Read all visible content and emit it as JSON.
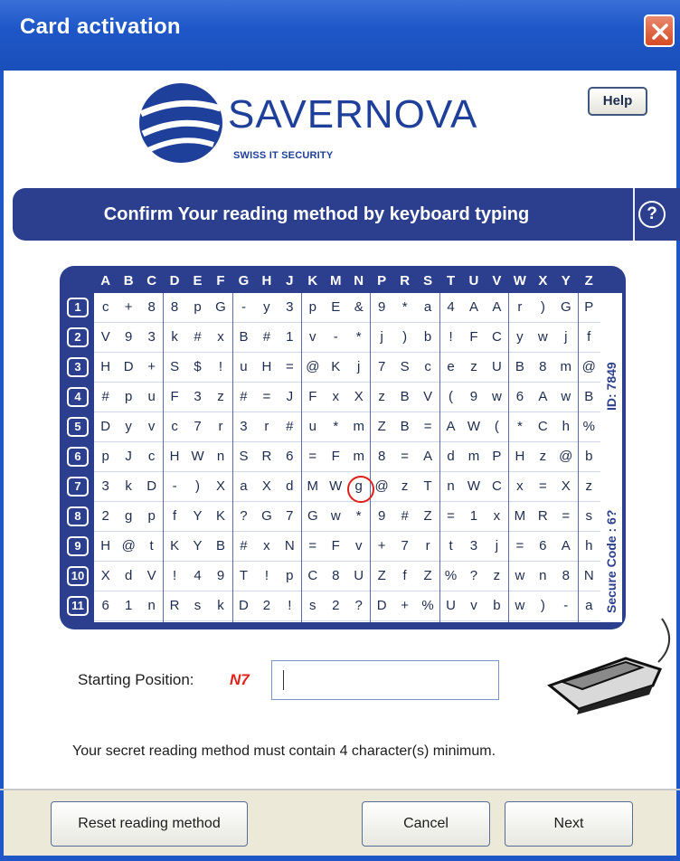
{
  "window": {
    "title": "Card activation"
  },
  "logo": {
    "name": "SAVERNOVA",
    "tagline": "SWISS IT SECURITY"
  },
  "help_label": "Help",
  "banner": {
    "text": "Confirm Your reading method by keyboard typing",
    "help_icon": "?"
  },
  "grid": {
    "columns": [
      "A",
      "B",
      "C",
      "D",
      "E",
      "F",
      "G",
      "H",
      "J",
      "K",
      "M",
      "N",
      "P",
      "R",
      "S",
      "T",
      "U",
      "V",
      "W",
      "X",
      "Y",
      "Z"
    ],
    "rows": [
      {
        "label": "1",
        "cells": [
          "c",
          "+",
          "8",
          "8",
          "p",
          "G",
          "-",
          "y",
          "3",
          "p",
          "E",
          "&",
          "9",
          "*",
          "a",
          "4",
          "A",
          "A",
          "r",
          ")",
          "G",
          "P"
        ]
      },
      {
        "label": "2",
        "cells": [
          "V",
          "9",
          "3",
          "k",
          "#",
          "x",
          "B",
          "#",
          "1",
          "v",
          "-",
          "*",
          "j",
          ")",
          "b",
          "!",
          "F",
          "C",
          "y",
          "w",
          "j",
          "f"
        ]
      },
      {
        "label": "3",
        "cells": [
          "H",
          "D",
          "+",
          "S",
          "$",
          "!",
          "u",
          "H",
          "=",
          "@",
          "K",
          "j",
          "7",
          "S",
          "c",
          "e",
          "z",
          "U",
          "B",
          "8",
          "m",
          "@"
        ]
      },
      {
        "label": "4",
        "cells": [
          "#",
          "p",
          "u",
          "F",
          "3",
          "z",
          "#",
          "=",
          "J",
          "F",
          "x",
          "X",
          "z",
          "B",
          "V",
          "(",
          "9",
          "w",
          "6",
          "A",
          "w",
          "B"
        ]
      },
      {
        "label": "5",
        "cells": [
          "D",
          "y",
          "v",
          "c",
          "7",
          "r",
          "3",
          "r",
          "#",
          "u",
          "*",
          "m",
          "Z",
          "B",
          "=",
          "A",
          "W",
          "(",
          "*",
          "C",
          "h",
          "%"
        ]
      },
      {
        "label": "6",
        "cells": [
          "p",
          "J",
          "c",
          "H",
          "W",
          "n",
          "S",
          "R",
          "6",
          "=",
          "F",
          "m",
          "8",
          "=",
          "A",
          "d",
          "m",
          "P",
          "H",
          "z",
          "@",
          "b"
        ]
      },
      {
        "label": "7",
        "cells": [
          "3",
          "k",
          "D",
          "-",
          ")",
          "X",
          "a",
          "X",
          "d",
          "M",
          "W",
          "g",
          "@",
          "z",
          "T",
          "n",
          "W",
          "C",
          "x",
          "=",
          "X",
          "z"
        ]
      },
      {
        "label": "8",
        "cells": [
          "2",
          "g",
          "p",
          "f",
          "Y",
          "K",
          "?",
          "G",
          "7",
          "G",
          "w",
          "*",
          "9",
          "#",
          "Z",
          "=",
          "1",
          "x",
          "M",
          "R",
          "=",
          "s"
        ]
      },
      {
        "label": "9",
        "cells": [
          "H",
          "@",
          "t",
          "K",
          "Y",
          "B",
          "#",
          "x",
          "N",
          "=",
          "F",
          "v",
          "+",
          "7",
          "r",
          "t",
          "3",
          "j",
          "=",
          "6",
          "A",
          "h"
        ]
      },
      {
        "label": "10",
        "cells": [
          "X",
          "d",
          "V",
          "!",
          "4",
          "9",
          "T",
          "!",
          "p",
          "C",
          "8",
          "U",
          "Z",
          "f",
          "Z",
          "%",
          "?",
          "z",
          "w",
          "n",
          "8",
          "N"
        ]
      },
      {
        "label": "11",
        "cells": [
          "6",
          "1",
          "n",
          "R",
          "s",
          "k",
          "D",
          "2",
          "!",
          "s",
          "2",
          "?",
          "D",
          "+",
          "%",
          "U",
          "v",
          "b",
          "w",
          ")",
          "-",
          "a"
        ]
      }
    ],
    "id_text": "ID: 7849",
    "secure_code_text": "Secure Code : 6?"
  },
  "start": {
    "label": "Starting Position:",
    "code": "N7",
    "value": ""
  },
  "info_text": "Your secret reading method must contain 4 character(s) minimum.",
  "buttons": {
    "reset": "Reset reading method",
    "cancel": "Cancel",
    "next": "Next"
  }
}
